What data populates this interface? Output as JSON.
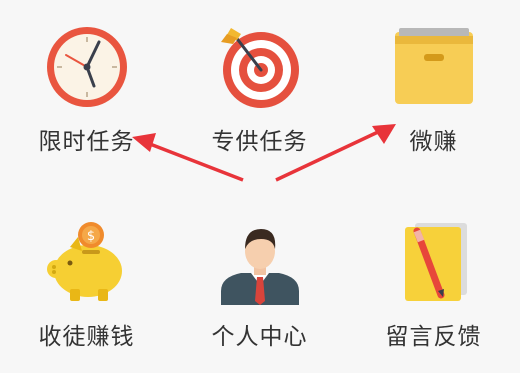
{
  "grid": {
    "items": [
      {
        "label": "限时任务",
        "icon": "alarm-clock-icon"
      },
      {
        "label": "专供任务",
        "icon": "target-dart-icon"
      },
      {
        "label": "微赚",
        "icon": "yellow-box-icon"
      },
      {
        "label": "收徒赚钱",
        "icon": "piggy-bank-icon"
      },
      {
        "label": "个人中心",
        "icon": "businessman-avatar-icon"
      },
      {
        "label": "留言反馈",
        "icon": "notepad-pencil-icon"
      }
    ]
  },
  "annotation": {
    "arrow_color": "#e8343a"
  },
  "colors": {
    "label_text": "#333333",
    "background": "#f7f7f7"
  }
}
